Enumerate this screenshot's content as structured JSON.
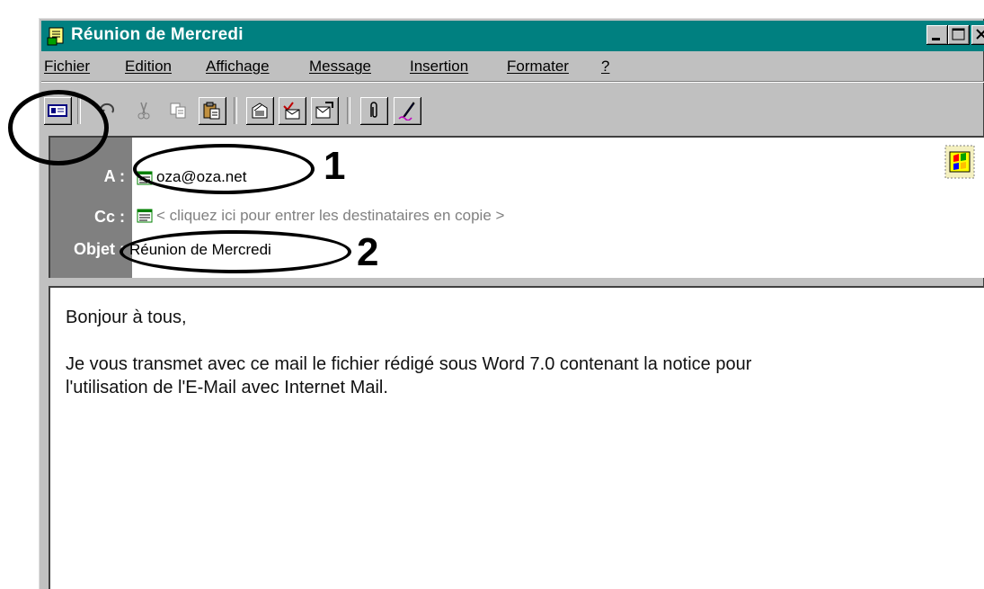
{
  "window": {
    "title": "Réunion de Mercredi",
    "controls": [
      "minimize-icon",
      "maximize-icon",
      "close-icon"
    ]
  },
  "menu": [
    {
      "label": "Fichier"
    },
    {
      "label": "Edition"
    },
    {
      "label": "Affichage"
    },
    {
      "label": "Message"
    },
    {
      "label": "Insertion"
    },
    {
      "label": "Formater"
    },
    {
      "label": "?"
    }
  ],
  "toolbar": [
    "send-icon",
    "undo-icon",
    "cut-icon",
    "copy-icon",
    "paste-icon",
    "address-book-icon",
    "check-names-icon",
    "select-recipients-icon",
    "attach-icon",
    "sign-icon"
  ],
  "header": {
    "to_label": "A :",
    "to_value": "oza@oza.net",
    "cc_label": "Cc :",
    "cc_placeholder": "< cliquez ici pour entrer les destinataires en copie >",
    "subject_label": "Objet :",
    "subject_value": "Réunion de Mercredi",
    "stamp_icon": "stamp-icon"
  },
  "annotations": {
    "marker_1": "1",
    "marker_2": "2"
  },
  "body": {
    "lines": [
      "Bonjour à tous,",
      "",
      "Je vous transmet avec ce mail le fichier rédigé sous Word 7.0 contenant la notice pour",
      "l'utilisation de l'E-Mail avec Internet Mail."
    ]
  },
  "colors": {
    "titlebar": "#008080",
    "chrome": "#c0c0c0",
    "label_pane": "#808080",
    "hint_text": "#808080"
  }
}
